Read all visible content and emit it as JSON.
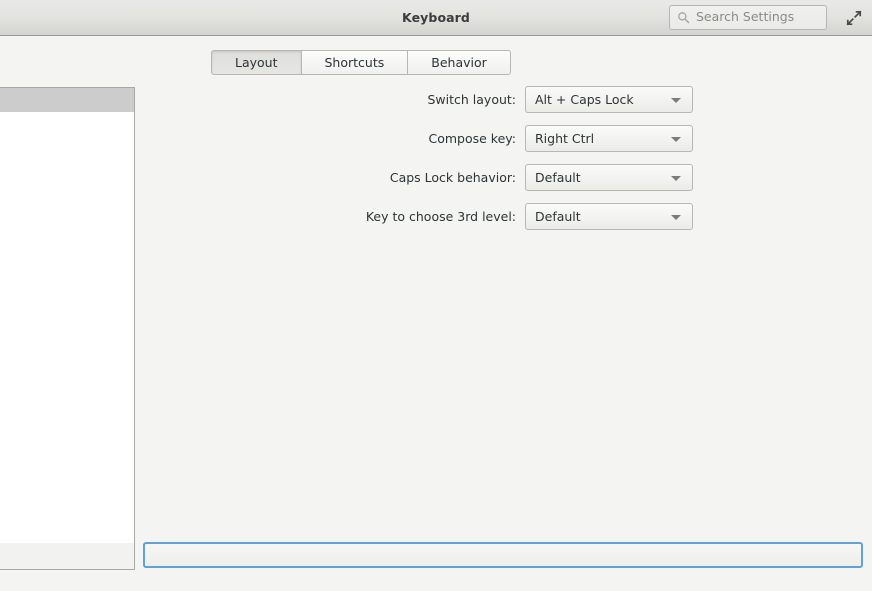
{
  "window": {
    "title": "Keyboard",
    "maximize_icon": "maximize-diagonal-arrows-icon"
  },
  "search": {
    "icon": "search-icon",
    "placeholder": "Search Settings",
    "value": ""
  },
  "tabs": [
    {
      "label": "Layout",
      "active": true
    },
    {
      "label": "Shortcuts",
      "active": false
    },
    {
      "label": "Behavior",
      "active": false
    }
  ],
  "settings": {
    "rows": [
      {
        "label": "Switch layout:",
        "value": "Alt + Caps Lock",
        "arrow_icon": "chevron-down-icon"
      },
      {
        "label": "Compose key:",
        "value": "Right Ctrl",
        "arrow_icon": "chevron-down-icon"
      },
      {
        "label": "Caps Lock behavior:",
        "value": "Default",
        "arrow_icon": "chevron-down-icon"
      },
      {
        "label": "Key to choose 3rd level:",
        "value": "Default",
        "arrow_icon": "chevron-down-icon"
      }
    ]
  },
  "layout_list": {
    "items": [],
    "toolbar_buttons": []
  },
  "bottom_bar": {
    "label": "",
    "focused": true
  },
  "colors": {
    "header_top": "#e9e9e7",
    "header_bottom": "#d4d4d0",
    "body_background": "#f4f4f2",
    "list_header": "#cccccc",
    "focus_outline": "#62a0d8",
    "border": "#b8b8b3",
    "text": "#2e3436",
    "placeholder_text": "#8a8a87"
  }
}
